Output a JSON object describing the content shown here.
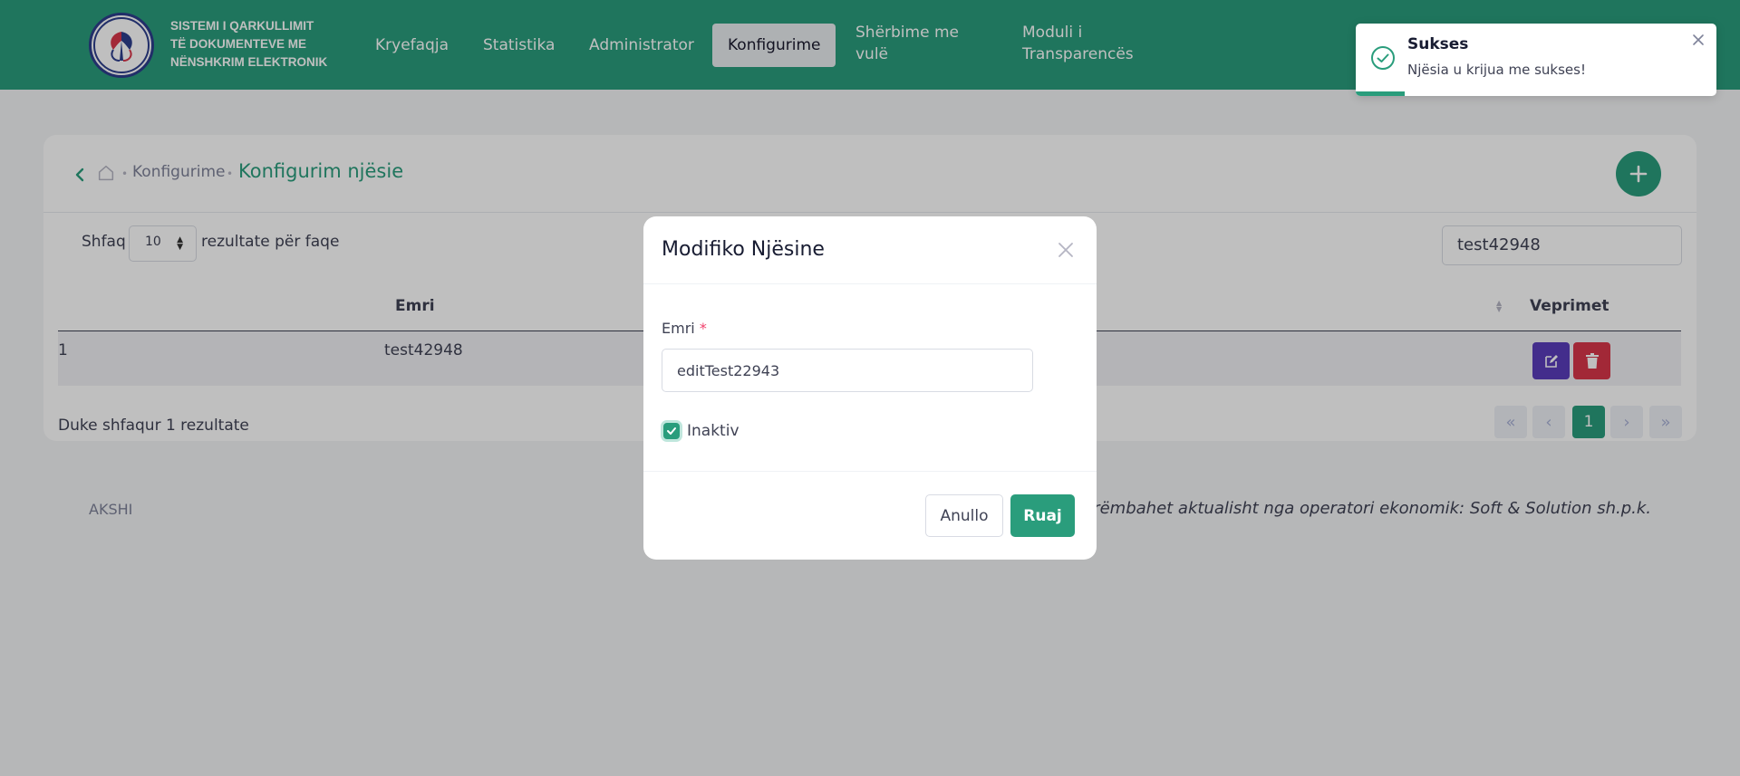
{
  "brand": {
    "lines": [
      "SISTEMI I QARKULLIMIT",
      "TË DOKUMENTEVE ME",
      "NËNSHKRIM ELEKTRONIK"
    ]
  },
  "nav": [
    {
      "label": "Kryefaqja"
    },
    {
      "label": "Statistika"
    },
    {
      "label": "Administrator"
    },
    {
      "label": "Konfigurime",
      "active": true
    },
    {
      "label_line1": "Shërbime me",
      "label_line2": "vulë"
    },
    {
      "label_line1": "Moduli i",
      "label_line2": "Transparencës"
    }
  ],
  "breadcrumb": {
    "parent": "Konfigurime",
    "current": "Konfigurim njësie"
  },
  "table_controls": {
    "show_label": "Shfaq",
    "page_size": "10",
    "per_page_label": "rezultate për faqe",
    "search_value": "test42948"
  },
  "table": {
    "columns": [
      "Emri",
      "Veprimet"
    ],
    "rows": [
      {
        "index": "1",
        "name": "test42948"
      }
    ],
    "summary": "Duke shfaqur 1 rezultate"
  },
  "pagination": {
    "current": "1"
  },
  "footer": {
    "left": "AKSHI",
    "right": "ronik mirëmbahet aktualisht nga operatori ekonomik: Soft & Solution sh.p.k."
  },
  "toast": {
    "title": "Sukses",
    "message": "Njësia u krijua me sukses!"
  },
  "modal": {
    "title": "Modifiko Njësine",
    "field_label": "Emri",
    "required_mark": "*",
    "field_value": "editTest22943",
    "checkbox_label": "Inaktiv",
    "checkbox_checked": true,
    "cancel_label": "Anullo",
    "save_label": "Ruaj"
  },
  "colors": {
    "primary": "#2a9d7c",
    "edit": "#5a3dbb",
    "delete": "#d9364a",
    "required": "#f1416c"
  }
}
